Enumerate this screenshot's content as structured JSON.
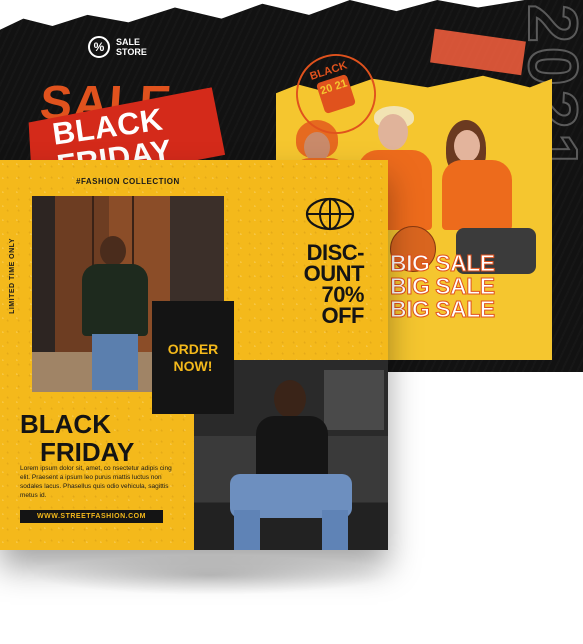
{
  "back_poster": {
    "logo_symbol": "%",
    "store_name": "SALE STORE",
    "sale_word": "SALE",
    "banner_line1": "BLACK",
    "banner_line2": "FRIDAY",
    "year_outline": "2021",
    "stamp_text": "BLACK",
    "stamp_year": "20 21",
    "big_sale_lines": [
      "BIG SALE",
      "BIG SALE",
      "BIG SALE"
    ],
    "colors": {
      "background": "#121212",
      "accent": "#e0521d",
      "banner": "#d42a1a",
      "photo_bg": "#f5c62f"
    }
  },
  "front_poster": {
    "fashion_tag": "#FASHION COLLECTION",
    "limited_text": "LIMITED TIME ONLY",
    "order_line1": "ORDER",
    "order_line2": "NOW!",
    "discount_lines": [
      "DISC-",
      "OUNT",
      "70%",
      "OFF"
    ],
    "title_line1": "BLACK",
    "title_line2": "FRIDAY",
    "body_text": "Lorem ipsum dolor sit, amet, co nsectetur adipis cing elit. Praesent a ipsum leo purus mattis luctus non sodales lacus. Phasellus quis odio vehicula, sagittis metus id.",
    "website": "WWW.STREETFASHION.COM",
    "icon": "basketball-icon",
    "colors": {
      "background": "#f4b91b",
      "dark": "#141414"
    }
  }
}
